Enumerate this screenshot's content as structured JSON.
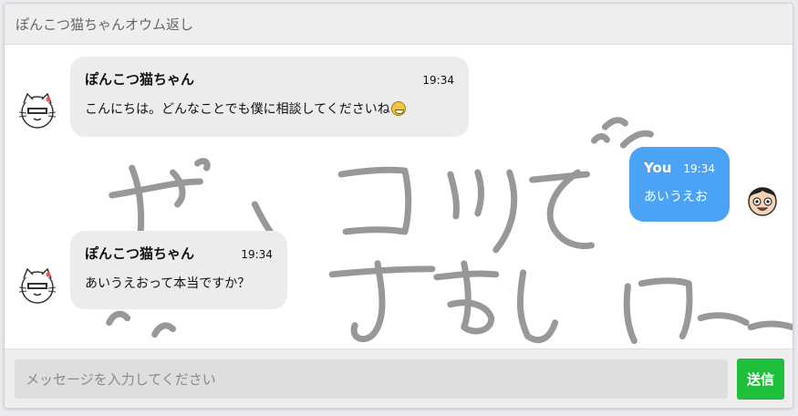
{
  "header": {
    "title": "ぽんこつ猫ちゃんオウム返し"
  },
  "messages": [
    {
      "side": "left",
      "name": "ぽんこつ猫ちゃん",
      "time": "19:34",
      "text": "こんにちは。どんなことでも僕に相談してくださいね",
      "emoji": "grinning-face-emoji"
    },
    {
      "side": "right",
      "name": "You",
      "time": "19:34",
      "text": "あいうえお"
    },
    {
      "side": "left",
      "name": "ぽんこつ猫ちゃん",
      "time": "19:34",
      "text": "あいうえおって本当ですか？"
    }
  ],
  "composer": {
    "placeholder": "メッセージを入力してください",
    "value": "",
    "send_label": "送信"
  },
  "icons": {
    "bot_avatar": "cat-avatar-icon",
    "user_avatar": "boy-avatar-icon"
  },
  "colors": {
    "user_bubble": "#4aa3f7",
    "bot_bubble": "#ececec",
    "send_button": "#1dbf3b"
  }
}
